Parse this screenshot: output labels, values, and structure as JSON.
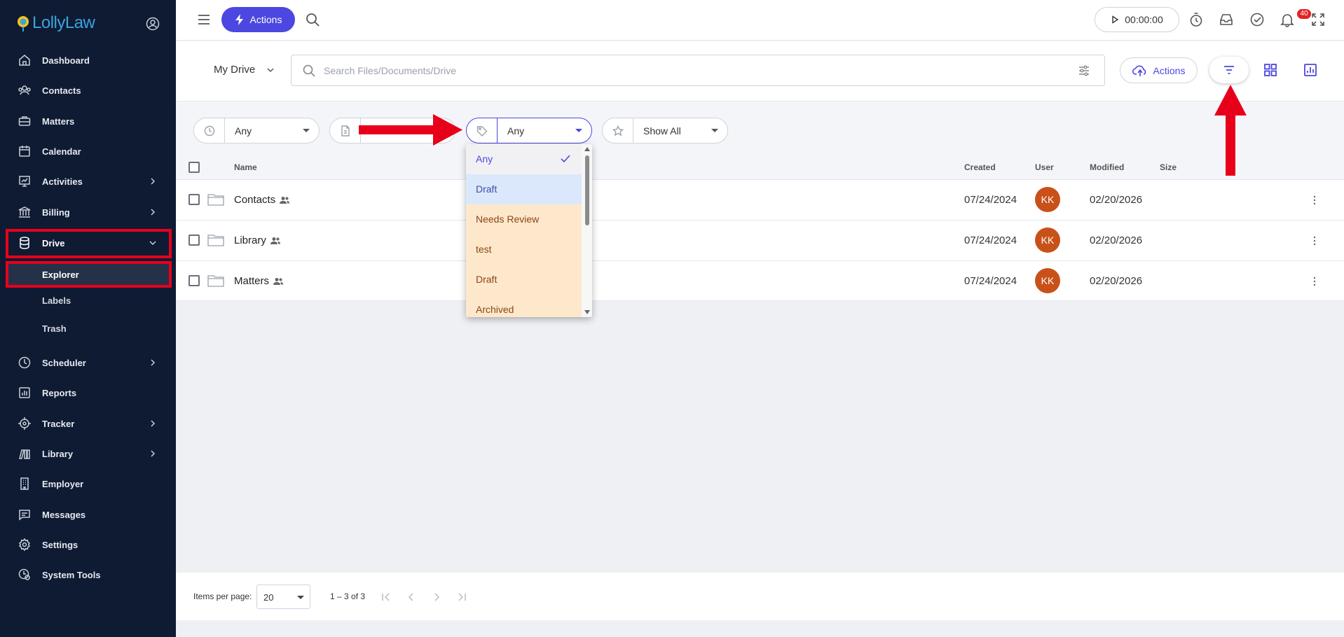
{
  "brand": {
    "name": "LollyLaw"
  },
  "sidebar": {
    "items": [
      {
        "label": "Dashboard",
        "icon": "home-icon"
      },
      {
        "label": "Contacts",
        "icon": "contacts-icon"
      },
      {
        "label": "Matters",
        "icon": "briefcase-icon"
      },
      {
        "label": "Calendar",
        "icon": "calendar-icon"
      },
      {
        "label": "Activities",
        "icon": "activities-icon"
      },
      {
        "label": "Billing",
        "icon": "bank-icon"
      },
      {
        "label": "Drive",
        "icon": "database-icon"
      },
      {
        "label": "Scheduler",
        "icon": "clock-icon"
      },
      {
        "label": "Reports",
        "icon": "reports-icon"
      },
      {
        "label": "Tracker",
        "icon": "target-icon"
      },
      {
        "label": "Library",
        "icon": "books-icon"
      },
      {
        "label": "Employer",
        "icon": "building-icon"
      },
      {
        "label": "Messages",
        "icon": "message-icon"
      },
      {
        "label": "Settings",
        "icon": "gear-icon"
      },
      {
        "label": "System Tools",
        "icon": "system-tools-icon"
      }
    ],
    "drive_sub": [
      "Explorer",
      "Labels",
      "Trash"
    ]
  },
  "topbar": {
    "actions_label": "Actions",
    "timer": "00:00:00",
    "notification_count": "40"
  },
  "drive": {
    "location": "My Drive",
    "search_placeholder": "Search Files/Documents/Drive",
    "actions_label": "Actions"
  },
  "filters": {
    "time": "Any",
    "tag": "Any",
    "favorites": "Show All"
  },
  "table": {
    "headers": {
      "name": "Name",
      "created": "Created",
      "user": "User",
      "modified": "Modified",
      "size": "Size"
    },
    "rows": [
      {
        "name": "Contacts",
        "created": "07/24/2024",
        "user": "KK",
        "modified": "02/20/2026",
        "size": ""
      },
      {
        "name": "Library",
        "created": "07/24/2024",
        "user": "KK",
        "modified": "02/20/2026",
        "size": ""
      },
      {
        "name": "Matters",
        "created": "07/24/2024",
        "user": "KK",
        "modified": "02/20/2026",
        "size": ""
      }
    ]
  },
  "tag_dropdown": {
    "options": [
      "Any",
      "Draft",
      "Needs Review",
      "test",
      "Draft",
      "Archived"
    ],
    "selected": "Any"
  },
  "footer": {
    "items_per_page_label": "Items per page:",
    "items_per_page": "20",
    "range": "1 – 3 of 3"
  },
  "colors": {
    "sidebar_bg": "#0f1b33",
    "accent": "#4c47e0",
    "highlight_red": "#e8001b",
    "avatar": "#c8511a"
  }
}
